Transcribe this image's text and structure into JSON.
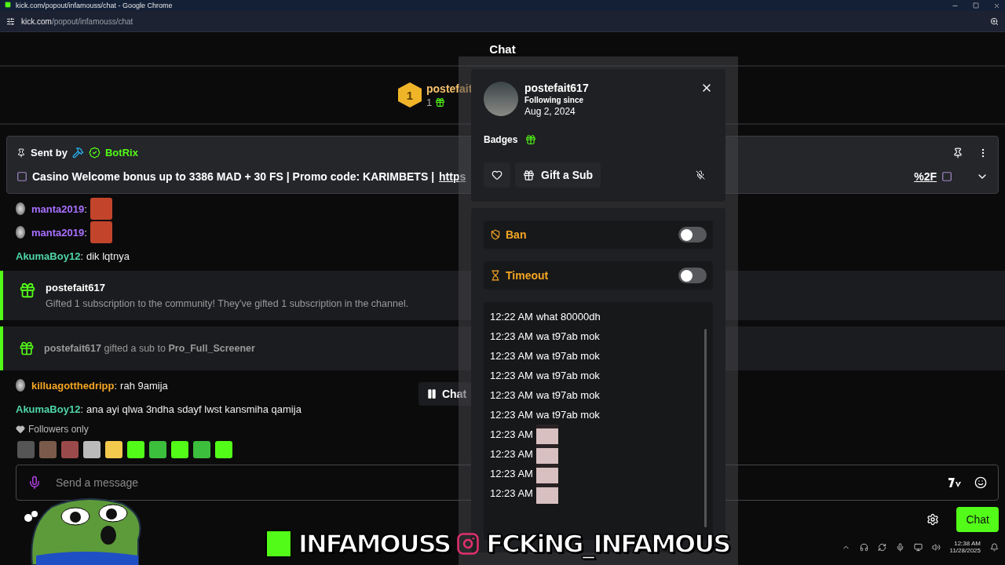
{
  "window": {
    "title": "kick.com/popout/infamouss/chat - Google Chrome"
  },
  "address_bar": {
    "host": "kick.com",
    "path": "/popout/infamouss/chat"
  },
  "header": {
    "title": "Chat"
  },
  "gift_leaderboard": {
    "rank": "1",
    "user": "postefait",
    "count": "1"
  },
  "pinned": {
    "label": "Sent by",
    "sender": "BotRix",
    "message": "Casino Welcome bonus up to 3386 MAD + 30 FS | Promo code: KARIMBETS |",
    "link_start": "https",
    "link_end": "%2F"
  },
  "messages": [
    {
      "kind": "emote",
      "user": "manta2019",
      "separator": ":",
      "color": "#a970ff",
      "badge": true
    },
    {
      "kind": "emote",
      "user": "manta2019",
      "separator": ":",
      "color": "#a970ff",
      "badge": true
    },
    {
      "kind": "text",
      "user": "AkumaBoy12",
      "separator": ":",
      "color": "#4fd6a8",
      "badge": false,
      "text": "dik lqtnya"
    },
    {
      "kind": "gift_community",
      "user": "postefait617",
      "text": "Gifted 1 subscription to the community! They've gifted 1 subscription in the channel."
    },
    {
      "kind": "gift_sub",
      "text": "**postefait617** gifted a sub to **Pro_Full_Screener**"
    },
    {
      "kind": "text",
      "user": "killuagotthedripp",
      "separator": ":",
      "color": "#f5a623",
      "badge": true,
      "text": "rah 9amija"
    },
    {
      "kind": "text",
      "user": "AkumaBoy12",
      "separator": ":",
      "color": "#4fd6a8",
      "badge": false,
      "text": "ana ayi qlwa 3ndha sdayf lwst kansmiha qamija"
    }
  ],
  "paused_button": {
    "label": "Chat"
  },
  "chat_mode": "Followers only",
  "composer": {
    "placeholder": "Send a message"
  },
  "chat_button": {
    "label": "Chat"
  },
  "user_card": {
    "username": "postefait617",
    "following_label": "Following since",
    "following_date": "Aug 2, 2024",
    "badges_label": "Badges",
    "gift_button": "Gift a Sub"
  },
  "moderation": [
    {
      "kind": "ban",
      "label": "Ban",
      "on": false
    },
    {
      "kind": "timeout",
      "label": "Timeout",
      "on": false
    }
  ],
  "message_log": [
    {
      "kind": "text",
      "time": "12:22 AM",
      "text": "what 80000dh"
    },
    {
      "kind": "text",
      "time": "12:23 AM",
      "text": "wa t97ab mok"
    },
    {
      "kind": "text",
      "time": "12:23 AM",
      "text": "wa t97ab mok"
    },
    {
      "kind": "text",
      "time": "12:23 AM",
      "text": "wa t97ab mok"
    },
    {
      "kind": "text",
      "time": "12:23 AM",
      "text": "wa t97ab mok"
    },
    {
      "kind": "text",
      "time": "12:23 AM",
      "text": "wa t97ab mok"
    },
    {
      "kind": "emote",
      "time": "12:23 AM"
    },
    {
      "kind": "emote",
      "time": "12:23 AM"
    },
    {
      "kind": "emote",
      "time": "12:23 AM"
    },
    {
      "kind": "emote",
      "time": "12:23 AM"
    }
  ],
  "overlay_banner": {
    "channel": "INFAMOUSS",
    "social": "FCKiNG_INFAMOUS"
  },
  "taskbar": {
    "time": "12:38 AM",
    "date": "11/28/2025"
  }
}
